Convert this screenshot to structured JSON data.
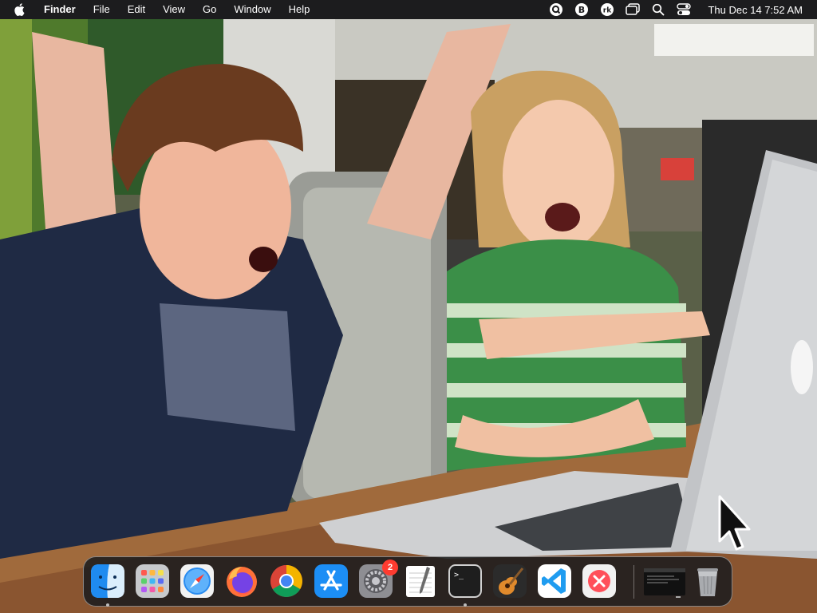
{
  "menubar": {
    "app_name": "Finder",
    "menus": [
      "File",
      "Edit",
      "View",
      "Go",
      "Window",
      "Help"
    ],
    "clock": "Thu Dec 14  7:52 AM",
    "status_icons": [
      "spotlight-search-status-icon",
      "bitcoin-icon",
      "user-initials-icon",
      "screen-mirroring-icon",
      "search-icon",
      "control-center-icon"
    ],
    "user_initials": "rk"
  },
  "dock": {
    "items": [
      {
        "name": "Finder",
        "icon": "finder-icon",
        "running": true
      },
      {
        "name": "Launchpad",
        "icon": "launchpad-icon",
        "running": false
      },
      {
        "name": "Safari",
        "icon": "safari-icon",
        "running": false
      },
      {
        "name": "Firefox",
        "icon": "firefox-icon",
        "running": false
      },
      {
        "name": "Google Chrome",
        "icon": "chrome-icon",
        "running": false
      },
      {
        "name": "App Store",
        "icon": "app-store-icon",
        "running": false
      },
      {
        "name": "System Preferences",
        "icon": "system-preferences-icon",
        "running": false,
        "badge": "2"
      },
      {
        "name": "TextEdit",
        "icon": "textedit-icon",
        "running": false
      },
      {
        "name": "Terminal",
        "icon": "terminal-icon",
        "running": true
      },
      {
        "name": "GarageBand",
        "icon": "garageband-icon",
        "running": false
      },
      {
        "name": "Visual Studio Code",
        "icon": "vscode-icon",
        "running": false
      },
      {
        "name": "Close App",
        "icon": "close-app-icon",
        "running": false
      },
      {
        "name": "Terminal Window",
        "icon": "window-thumbnail-icon",
        "running": false
      },
      {
        "name": "Trash",
        "icon": "trash-icon",
        "running": false
      }
    ]
  },
  "wallpaper": {
    "description_icon": "photo-wallpaper"
  },
  "colors": {
    "menubar_bg": "#1c1c1e",
    "dock_bg": "#1c1c1e",
    "badge": "#ff3b30"
  }
}
